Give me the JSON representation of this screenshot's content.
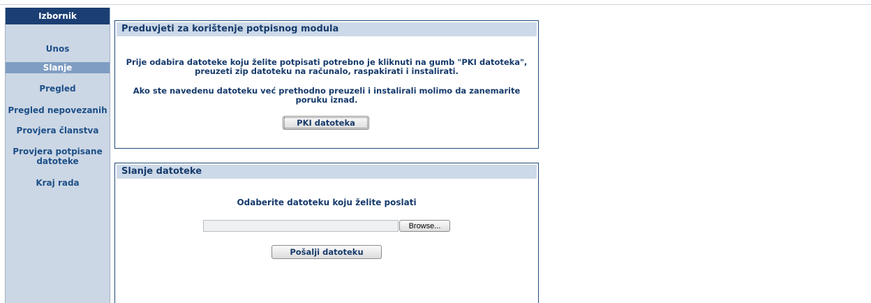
{
  "sidebar": {
    "title": "Izbornik",
    "items": [
      {
        "label": "Unos"
      },
      {
        "label": "Slanje"
      },
      {
        "label": "Pregled"
      },
      {
        "label": "Pregled nepovezanih"
      },
      {
        "label": "Provjera članstva"
      },
      {
        "label": "Provjera potpisane datoteke"
      },
      {
        "label": "Kraj rada"
      }
    ],
    "active_item": "Slanje"
  },
  "prerequisites": {
    "title": "Preduvjeti za korištenje potpisnog modula",
    "paragraph1_line1": "Prije odabira datoteke koju želite potpisati potrebno je kliknuti na gumb \"PKI datoteka\",",
    "paragraph1_line2": "preuzeti zip datoteku na računalo, raspakirati i instalirati.",
    "paragraph2_line1": "Ako ste navedenu datoteku već prethodno preuzeli i instalirali molimo da zanemarite",
    "paragraph2_line2": "poruku iznad.",
    "pki_button_label": "PKI datoteka"
  },
  "upload": {
    "title": "Slanje datoteke",
    "instruction": "Odaberite datoteku koju želite poslati",
    "file_value": "",
    "browse_label": "Browse...",
    "send_button_label": "Pošalji datoteku"
  },
  "colors": {
    "sidebar_header": "#1b3f73",
    "sidebar_bg": "#ccd7e5",
    "active_item_bg": "#7f9dc2",
    "panel_header_bg": "#ccd9e8",
    "text": "#163a6b"
  }
}
